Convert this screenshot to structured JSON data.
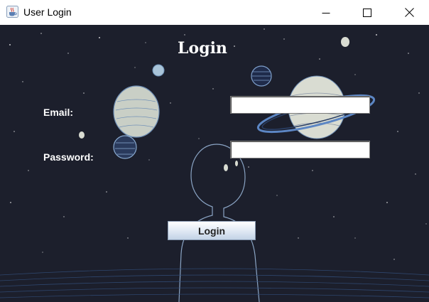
{
  "window": {
    "title": "User Login",
    "icon": "java-cup-icon",
    "controls": [
      "minimize-icon",
      "maximize-icon",
      "close-icon"
    ]
  },
  "form": {
    "heading": "Login",
    "email_label": "Email:",
    "email_value": "",
    "password_label": "Password:",
    "password_value": "",
    "login_button": "Login"
  },
  "colors": {
    "background": "#1c1f2c",
    "text": "#ffffff",
    "planet": "#d9dcd2",
    "outline": "#3b5f9c"
  }
}
